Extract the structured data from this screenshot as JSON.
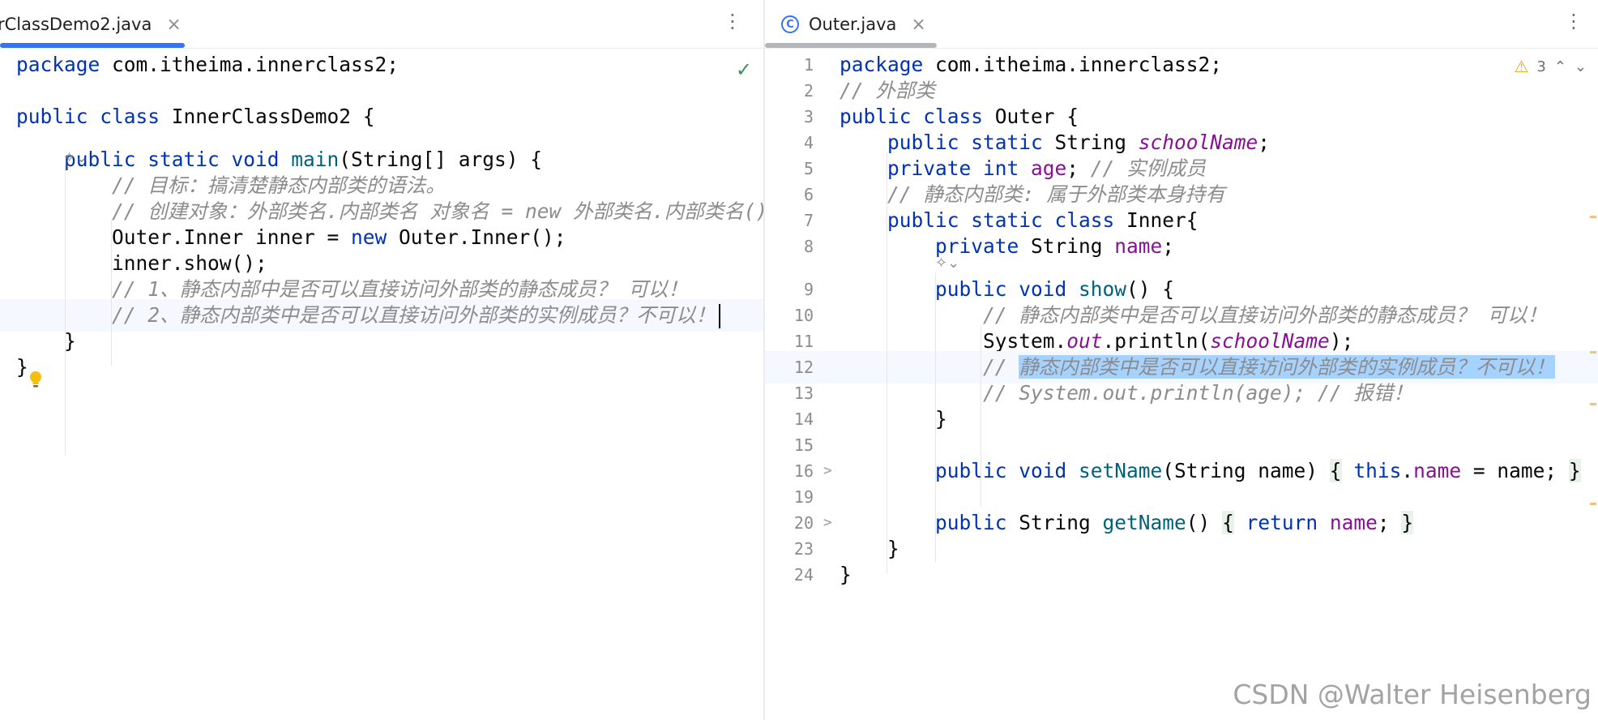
{
  "left_pane": {
    "tab": {
      "label": "rClassDemo2.java",
      "close": "×",
      "kebab": "⋮"
    },
    "status_check": "✓",
    "ai_hint": "✧⌄",
    "lines": [
      {
        "t": [
          [
            "kw",
            "package "
          ],
          [
            "",
            "com.itheima.innerclass2;"
          ]
        ]
      },
      {
        "t": []
      },
      {
        "t": [
          [
            "kw",
            "public class "
          ],
          [
            "",
            "InnerClassDemo2 {"
          ]
        ]
      },
      {
        "t": [
          [
            "kw",
            "    public static void "
          ],
          [
            "mth",
            "main"
          ],
          [
            "",
            "(String[] args) {"
          ]
        ]
      },
      {
        "t": [
          [
            "cm",
            "        // 目标：搞清楚静态内部类的语法。"
          ]
        ]
      },
      {
        "t": [
          [
            "cm",
            "        // 创建对象：外部类名.内部类名 对象名 = new 外部类名.内部类名();"
          ]
        ]
      },
      {
        "t": [
          [
            "",
            "        Outer.Inner inner = "
          ],
          [
            "kw",
            "new "
          ],
          [
            "",
            "Outer.Inner();"
          ]
        ]
      },
      {
        "t": [
          [
            "",
            "        inner.show();"
          ]
        ]
      },
      {
        "t": [
          [
            "cm",
            "        // 1、静态内部中是否可以直接访问外部类的静态成员？ 可以！"
          ]
        ]
      },
      {
        "t": [
          [
            "cm",
            "        // 2、静态内部类中是否可以直接访问外部类的实例成员？不可以！"
          ]
        ]
      },
      {
        "t": [
          [
            "",
            "    }"
          ]
        ]
      },
      {
        "t": [
          [
            "",
            "}"
          ]
        ]
      }
    ]
  },
  "right_pane": {
    "tab": {
      "icon_letter": "C",
      "label": "Outer.java",
      "close": "×",
      "kebab": "⋮"
    },
    "warnings": {
      "icon": "⚠",
      "count": "3",
      "up": "⌃",
      "down": "⌄"
    },
    "ai_hint": "✧⌄",
    "fold_marker": ">",
    "lines": [
      {
        "n": "1",
        "t": [
          [
            "kw",
            "package "
          ],
          [
            "",
            "com.itheima.innerclass2;"
          ]
        ]
      },
      {
        "n": "2",
        "t": [
          [
            "cm",
            "// 外部类"
          ]
        ]
      },
      {
        "n": "3",
        "t": [
          [
            "kw",
            "public class "
          ],
          [
            "",
            "Outer {"
          ]
        ]
      },
      {
        "n": "4",
        "t": [
          [
            "kw",
            "    public static "
          ],
          [
            "",
            "String "
          ],
          [
            "st-fld",
            "schoolName"
          ],
          [
            "",
            ";"
          ]
        ]
      },
      {
        "n": "5",
        "t": [
          [
            "kw",
            "    private int "
          ],
          [
            "fld",
            "age"
          ],
          [
            "",
            "; "
          ],
          [
            "cm",
            "// 实例成员"
          ]
        ]
      },
      {
        "n": "6",
        "t": [
          [
            "cm",
            "    // 静态内部类: 属于外部类本身持有"
          ]
        ]
      },
      {
        "n": "7",
        "t": [
          [
            "kw",
            "    public static class "
          ],
          [
            "",
            "Inner{"
          ]
        ]
      },
      {
        "n": "8",
        "t": [
          [
            "kw",
            "        private "
          ],
          [
            "",
            "String "
          ],
          [
            "fld",
            "name"
          ],
          [
            "",
            ";"
          ]
        ]
      },
      {
        "n": "9",
        "t": [
          [
            "kw",
            "        public void "
          ],
          [
            "mth",
            "show"
          ],
          [
            "",
            "() {"
          ]
        ]
      },
      {
        "n": "10",
        "t": [
          [
            "cm",
            "            // 静态内部类中是否可以直接访问外部类的静态成员？ 可以！"
          ]
        ]
      },
      {
        "n": "11",
        "t": [
          [
            "",
            "            System."
          ],
          [
            "st-fld",
            "out"
          ],
          [
            "",
            ".println("
          ],
          [
            "st-fld",
            "schoolName"
          ],
          [
            "",
            ");"
          ]
        ]
      },
      {
        "n": "12",
        "t": [
          [
            "cm",
            "            // "
          ],
          [
            "cm sel",
            "静态内部类中是否可以直接访问外部类的实例成员？不可以！"
          ]
        ]
      },
      {
        "n": "13",
        "t": [
          [
            "cm",
            "            // System.out.println(age); // 报错！"
          ]
        ]
      },
      {
        "n": "14",
        "t": [
          [
            "",
            "        }"
          ]
        ]
      },
      {
        "n": "15",
        "t": []
      },
      {
        "n": "16",
        "t": [
          [
            "kw",
            "        public void "
          ],
          [
            "mth",
            "setName"
          ],
          [
            "",
            "(String name) "
          ],
          [
            "brace-hl",
            "{"
          ],
          [
            "",
            " "
          ],
          [
            "kw",
            "this"
          ],
          [
            "",
            "."
          ],
          [
            "fld",
            "name"
          ],
          [
            "",
            " = name; "
          ],
          [
            "brace-hl",
            "}"
          ]
        ]
      },
      {
        "n": "19",
        "t": []
      },
      {
        "n": "20",
        "t": [
          [
            "kw",
            "        public "
          ],
          [
            "",
            "String "
          ],
          [
            "mth",
            "getName"
          ],
          [
            "",
            "() "
          ],
          [
            "brace-hl",
            "{"
          ],
          [
            "",
            " "
          ],
          [
            "kw",
            "return "
          ],
          [
            "fld",
            "name"
          ],
          [
            "",
            "; "
          ],
          [
            "brace-hl",
            "}"
          ]
        ]
      },
      {
        "n": "23",
        "t": [
          [
            "",
            "    }"
          ]
        ]
      },
      {
        "n": "24",
        "t": [
          [
            "",
            "}"
          ]
        ]
      }
    ]
  },
  "watermark": "CSDN @Walter Heisenberg"
}
